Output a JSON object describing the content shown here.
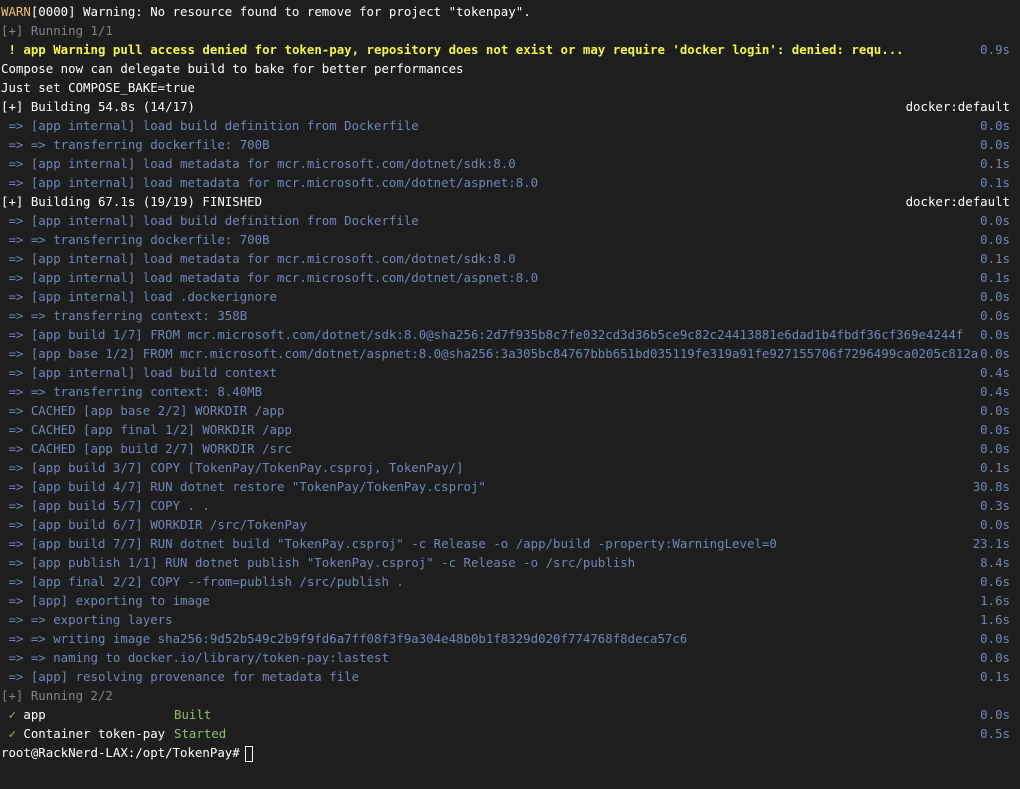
{
  "colors": {
    "background": "#1e1e1e",
    "warn": "#e5c07b",
    "step": "#6f86b8",
    "success": "#8cc265",
    "highlight": "#f5f543"
  },
  "warn_line": {
    "tag": "WARN",
    "text": "[0000] Warning: No resource found to remove for project \"tokenpay\"."
  },
  "running1": "[+] Running 1/1",
  "app_warning": {
    "prefix": " ! app Warning ",
    "message": "pull access denied for token-pay, repository does not exist or may require 'docker login': denied: requ...",
    "time": "0.9s"
  },
  "bake_lines": [
    "Compose now can delegate build to bake for better performances",
    "Just set COMPOSE_BAKE=true"
  ],
  "build1": {
    "header": "[+] Building 54.8s (14/17)",
    "target": "docker:default",
    "steps": [
      {
        "text": " => [app internal] load build definition from Dockerfile",
        "time": "0.0s"
      },
      {
        "text": " => => transferring dockerfile: 700B",
        "time": "0.0s"
      },
      {
        "text": " => [app internal] load metadata for mcr.microsoft.com/dotnet/sdk:8.0",
        "time": "0.1s"
      },
      {
        "text": " => [app internal] load metadata for mcr.microsoft.com/dotnet/aspnet:8.0",
        "time": "0.1s"
      }
    ]
  },
  "build2": {
    "header": "[+] Building 67.1s (19/19) FINISHED",
    "target": "docker:default",
    "steps": [
      {
        "text": " => [app internal] load build definition from Dockerfile",
        "time": "0.0s"
      },
      {
        "text": " => => transferring dockerfile: 700B",
        "time": "0.0s"
      },
      {
        "text": " => [app internal] load metadata for mcr.microsoft.com/dotnet/sdk:8.0",
        "time": "0.1s"
      },
      {
        "text": " => [app internal] load metadata for mcr.microsoft.com/dotnet/aspnet:8.0",
        "time": "0.1s"
      },
      {
        "text": " => [app internal] load .dockerignore",
        "time": "0.0s"
      },
      {
        "text": " => => transferring context: 358B",
        "time": "0.0s"
      },
      {
        "text": " => [app build 1/7] FROM mcr.microsoft.com/dotnet/sdk:8.0@sha256:2d7f935b8c7fe032cd3d36b5ce9c82c24413881e6dad1b4fbdf36cf369e4244f",
        "time": "0.0s"
      },
      {
        "text": " => [app base 1/2] FROM mcr.microsoft.com/dotnet/aspnet:8.0@sha256:3a305bc84767bbb651bd035119fe319a91fe927155706f7296499ca0205c812a",
        "time": "0.0s"
      },
      {
        "text": " => [app internal] load build context",
        "time": "0.4s"
      },
      {
        "text": " => => transferring context: 8.40MB",
        "time": "0.4s"
      },
      {
        "text": " => CACHED [app base 2/2] WORKDIR /app",
        "time": "0.0s"
      },
      {
        "text": " => CACHED [app final 1/2] WORKDIR /app",
        "time": "0.0s"
      },
      {
        "text": " => CACHED [app build 2/7] WORKDIR /src",
        "time": "0.0s"
      },
      {
        "text": " => [app build 3/7] COPY [TokenPay/TokenPay.csproj, TokenPay/]",
        "time": "0.1s"
      },
      {
        "text": " => [app build 4/7] RUN dotnet restore \"TokenPay/TokenPay.csproj\"",
        "time": "30.8s"
      },
      {
        "text": " => [app build 5/7] COPY . .",
        "time": "0.3s"
      },
      {
        "text": " => [app build 6/7] WORKDIR /src/TokenPay",
        "time": "0.0s"
      },
      {
        "text": " => [app build 7/7] RUN dotnet build \"TokenPay.csproj\" -c Release -o /app/build -property:WarningLevel=0",
        "time": "23.1s"
      },
      {
        "text": " => [app publish 1/1] RUN dotnet publish \"TokenPay.csproj\" -c Release -o /src/publish",
        "time": "8.4s"
      },
      {
        "text": " => [app final 2/2] COPY --from=publish /src/publish .",
        "time": "0.6s"
      },
      {
        "text": " => [app] exporting to image",
        "time": "1.6s"
      },
      {
        "text": " => => exporting layers",
        "time": "1.6s"
      },
      {
        "text": " => => writing image sha256:9d52b549c2b9f9fd6a7ff08f3f9a304e48b0b1f8329d020f774768f8deca57c6",
        "time": "0.0s"
      },
      {
        "text": " => => naming to docker.io/library/token-pay:lastest",
        "time": "0.0s"
      },
      {
        "text": " => [app] resolving provenance for metadata file",
        "time": "0.1s"
      }
    ]
  },
  "running2": "[+] Running 2/2",
  "results": [
    {
      "check": " ✓ ",
      "name": "app",
      "status": "Built",
      "time": "0.0s"
    },
    {
      "check": " ✓ ",
      "name": "Container token-pay",
      "status": "Started",
      "time": "0.5s"
    }
  ],
  "prompt": "root@RackNerd-LAX:/opt/TokenPay#"
}
